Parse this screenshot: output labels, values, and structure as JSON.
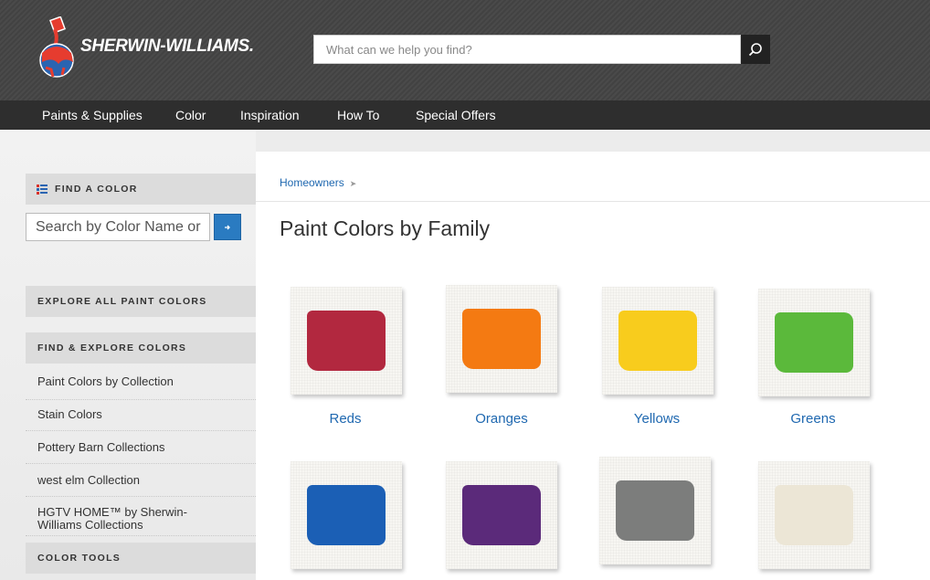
{
  "header": {
    "brand": "SHERWIN-WILLIAMS.",
    "search_placeholder": "What can we help you find?"
  },
  "nav": {
    "items": [
      "Paints & Supplies",
      "Color",
      "Inspiration",
      "How To",
      "Special Offers"
    ]
  },
  "sidebar": {
    "find_a_color": "FIND A COLOR",
    "color_search_placeholder": "Search by Color Name or",
    "explore_all": "EXPLORE ALL PAINT COLORS",
    "find_explore": "FIND & EXPLORE COLORS",
    "links": [
      "Paint Colors by Collection",
      "Stain Colors",
      "Pottery Barn Collections",
      "west elm Collection",
      "HGTV HOME™ by Sherwin-Williams Collections"
    ],
    "color_tools": "COLOR TOOLS"
  },
  "main": {
    "breadcrumb": "Homeowners",
    "title": "Paint Colors by Family",
    "families": [
      {
        "label": "Reds",
        "color": "#b2283f"
      },
      {
        "label": "Oranges",
        "color": "#f47a12"
      },
      {
        "label": "Yellows",
        "color": "#f8cc1d"
      },
      {
        "label": "Greens",
        "color": "#5bb93b"
      },
      {
        "label": "",
        "color": "#1b5fb5"
      },
      {
        "label": "",
        "color": "#5b2a7a"
      },
      {
        "label": "",
        "color": "#7c7d7c"
      },
      {
        "label": "",
        "color": "#ece6d6"
      }
    ]
  }
}
